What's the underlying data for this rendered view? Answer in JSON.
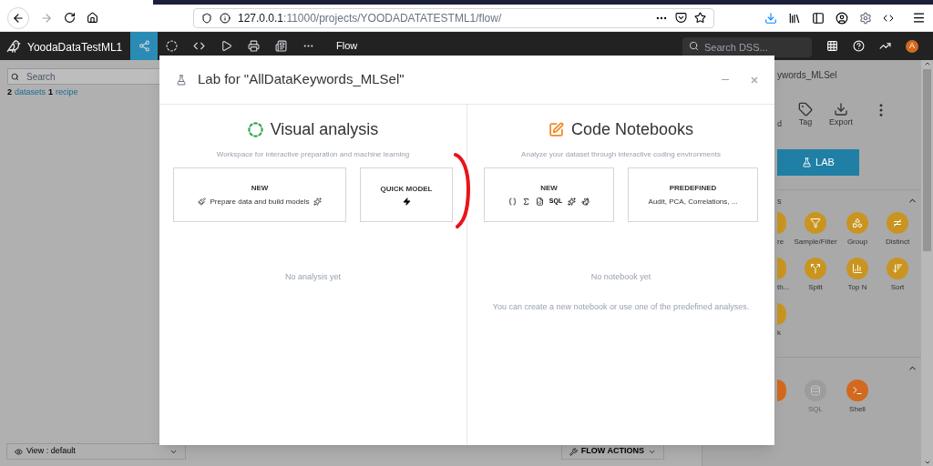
{
  "browser": {
    "url_host": "127.0.0.1",
    "url_rest": ":11000/projects/YOODADATATESTML1/flow/"
  },
  "app_bar": {
    "project": "YoodaDataTestML1",
    "tabs": [
      {
        "kind": "flow",
        "selected": true
      },
      {
        "kind": "lab",
        "selected": false
      },
      {
        "kind": "code",
        "selected": false
      },
      {
        "kind": "jobs",
        "selected": false
      },
      {
        "kind": "deploy",
        "selected": false
      },
      {
        "kind": "dashboards",
        "selected": false
      },
      {
        "kind": "more",
        "selected": false
      }
    ],
    "section": "Flow",
    "search_placeholder": "Search DSS...",
    "avatar": "A"
  },
  "left_panel": {
    "search_placeholder": "Search",
    "summary": [
      {
        "text": "2",
        "kind": "count"
      },
      {
        "text": "datasets",
        "kind": "link"
      },
      {
        "text": "1",
        "kind": "count"
      },
      {
        "text": "recipe",
        "kind": "link"
      }
    ]
  },
  "bottom_bar": {
    "view": "View : default",
    "flow_actions": "FLOW ACTIONS"
  },
  "right_panel": {
    "title": "ywords_MLSel",
    "actions": [
      {
        "kind": "partial",
        "label": "d"
      },
      {
        "kind": "tag",
        "label": "Tag"
      },
      {
        "kind": "export",
        "label": "Export"
      },
      {
        "kind": "more"
      }
    ],
    "lab_button": "LAB",
    "sections": [
      {
        "heading": "s",
        "items": [
          {
            "kind": "partial",
            "label": "re"
          },
          {
            "kind": "filter",
            "label": "Sample/Filter"
          },
          {
            "kind": "group",
            "label": "Group"
          },
          {
            "kind": "distinct",
            "label": "Distinct"
          },
          {
            "kind": "partial",
            "label": "th..."
          },
          {
            "kind": "split",
            "label": "Split"
          },
          {
            "kind": "topn",
            "label": "Top N"
          },
          {
            "kind": "sort",
            "label": "Sort"
          },
          {
            "kind": "partial",
            "label": "k"
          }
        ]
      },
      {
        "items": [
          {
            "kind": "partial"
          },
          {
            "kind": "sql",
            "label": "SQL",
            "disabled": true
          },
          {
            "kind": "shell",
            "label": "Shell",
            "disabled": false
          }
        ]
      }
    ]
  },
  "modal": {
    "title": "Lab for \"AllDataKeywords_MLSel\"",
    "columns": [
      {
        "kind": "visual",
        "title": "Visual analysis",
        "subtitle": "Workspace for interactive preparation and machine learning",
        "cards": [
          {
            "kind": "new",
            "title": "NEW",
            "text": "Prepare data and build models"
          },
          {
            "kind": "quick",
            "title": "QUICK MODEL"
          }
        ],
        "empty": [
          "No analysis yet"
        ]
      },
      {
        "kind": "code",
        "title": "Code Notebooks",
        "subtitle": "Analyze your dataset through interactive coding environments",
        "cards": [
          {
            "kind": "languages",
            "title": "NEW",
            "languages": [
              {
                "kind": "python"
              },
              {
                "kind": "r"
              },
              {
                "kind": "scala"
              },
              {
                "kind": "sql",
                "text": "SQL"
              },
              {
                "kind": "spark"
              },
              {
                "kind": "julia"
              }
            ]
          },
          {
            "kind": "predefined",
            "title": "PREDEFINED",
            "text": "Audit, PCA, Correlations, ..."
          }
        ],
        "empty": [
          "No notebook yet",
          "You can create a new notebook or use one of the predefined analyses."
        ]
      }
    ]
  }
}
